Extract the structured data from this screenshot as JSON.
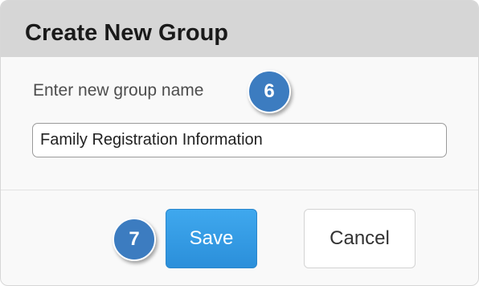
{
  "dialog": {
    "title": "Create New Group",
    "prompt_label": "Enter new group name",
    "group_name_value": "Family Registration Information",
    "save_label": "Save",
    "cancel_label": "Cancel"
  },
  "annotations": {
    "step_6": "6",
    "step_7": "7"
  },
  "colors": {
    "header_bg": "#d6d6d6",
    "save_button": "#3fa8ee",
    "step_badge": "#3c7cc0"
  }
}
